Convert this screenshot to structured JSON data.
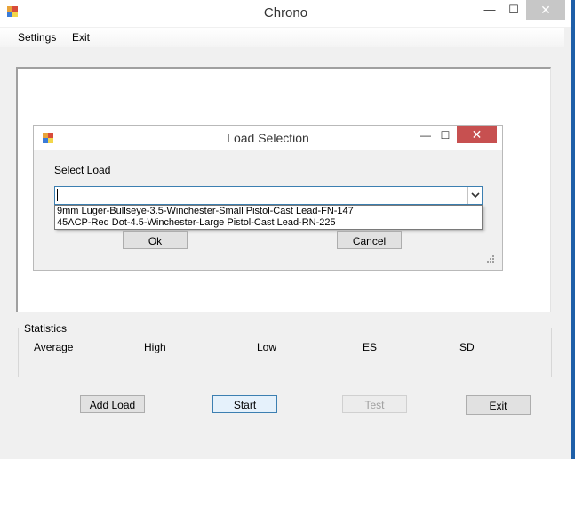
{
  "window": {
    "title": "Chrono",
    "controls": {
      "minimize": "—",
      "maximize": "☐",
      "close": "✕"
    }
  },
  "menu": {
    "items": [
      "Settings",
      "Exit"
    ]
  },
  "statistics": {
    "legend": "Statistics",
    "labels": [
      "Average",
      "High",
      "Low",
      "ES",
      "SD"
    ]
  },
  "buttons": {
    "add_load": "Add Load",
    "start": "Start",
    "test": "Test",
    "exit": "Exit"
  },
  "dialog": {
    "title": "Load Selection",
    "controls": {
      "minimize": "—",
      "maximize": "☐",
      "close": "✕"
    },
    "select_label": "Select Load",
    "combo_value": "",
    "options": [
      "9mm Luger-Bullseye-3.5-Winchester-Small Pistol-Cast Lead-FN-147",
      "45ACP-Red Dot-4.5-Winchester-Large Pistol-Cast Lead-RN-225"
    ],
    "ok": "Ok",
    "cancel": "Cancel"
  },
  "colors": {
    "window_bg": "#f0f0f0",
    "close_active": "#c75050",
    "focus_border": "#3c7fb1",
    "desktop_edge": "#1e5fa8"
  },
  "icons": {
    "app": "app-icon",
    "dropdown": "chevron-down-icon",
    "resize": "resize-grip-icon"
  }
}
